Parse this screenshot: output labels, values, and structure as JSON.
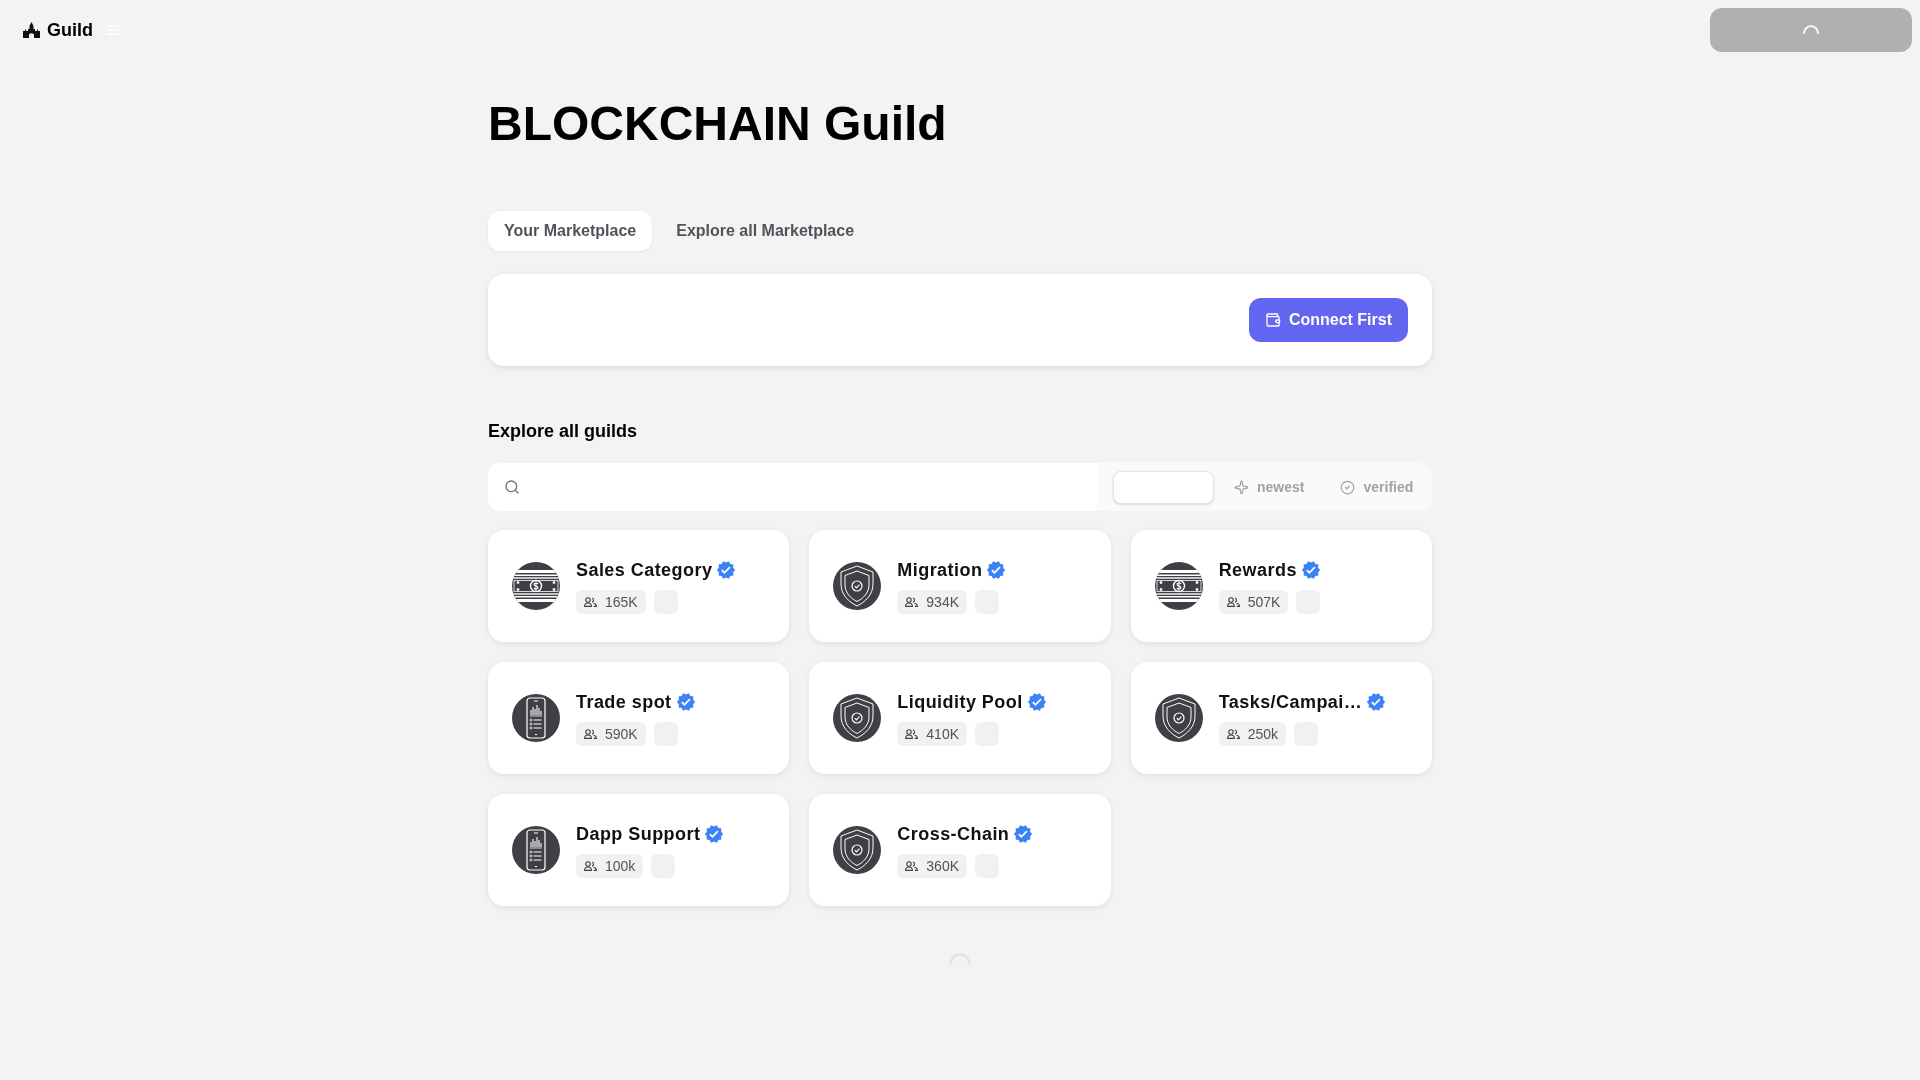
{
  "header": {
    "logo_text": "Guild"
  },
  "account_button": {
    "loading": true
  },
  "title": "BLOCKCHAIN Guild",
  "tabs": [
    {
      "label": "Your Marketplace",
      "selected": true
    },
    {
      "label": "Explore all Marketplace",
      "selected": false
    }
  ],
  "connect_card": {
    "button": "Connect First"
  },
  "section_title": "Explore all guilds",
  "search": {
    "sort_options": [
      {
        "kind": "plain",
        "selected": true
      },
      {
        "kind": "newest",
        "label": "newest",
        "selected": false
      },
      {
        "kind": "verified",
        "label": "verified",
        "selected": false
      }
    ]
  },
  "guilds": [
    {
      "name": "Sales Category",
      "verified": true,
      "members": "165K",
      "kind": "money"
    },
    {
      "name": "Migration",
      "verified": true,
      "members": "934K",
      "kind": "shield"
    },
    {
      "name": "Rewards",
      "verified": true,
      "members": "507K",
      "kind": "money"
    },
    {
      "name": "Trade spot",
      "verified": true,
      "members": "590K",
      "kind": "phone"
    },
    {
      "name": "Liquidity Pool",
      "verified": true,
      "members": "410K",
      "kind": "shield"
    },
    {
      "name": "Tasks/Campai…",
      "verified": true,
      "members": "250k",
      "kind": "shield"
    },
    {
      "name": "Dapp Support",
      "verified": true,
      "members": "100k",
      "kind": "phone"
    },
    {
      "name": "Cross-Chain",
      "verified": true,
      "members": "360K",
      "kind": "shield"
    }
  ],
  "loading_more": true
}
